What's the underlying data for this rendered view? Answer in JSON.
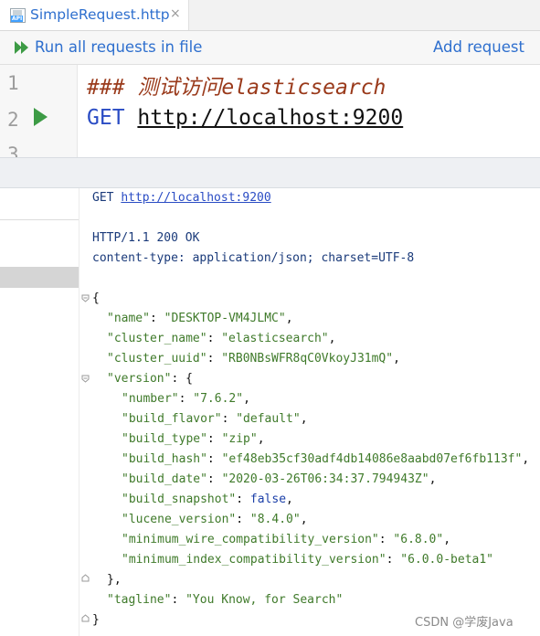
{
  "tab": {
    "title": "SimpleRequest.http",
    "icon_label": "API",
    "close": "×"
  },
  "toolbar": {
    "run_all": "Run all requests in file",
    "add_request": "Add request"
  },
  "editor": {
    "line_numbers": [
      "1",
      "2",
      "3"
    ],
    "line1": "### 测试访问elasticsearch",
    "line2_method": "GET",
    "line2_url": "http://localhost:9200"
  },
  "response": {
    "request_method": "GET",
    "request_url": "http://localhost:9200",
    "status": "HTTP/1.1 200 OK",
    "content_type": "content-type: application/json; charset=UTF-8",
    "body": [
      {
        "k": null,
        "text": "{"
      },
      {
        "k": "\"name\"",
        "v": "\"DESKTOP-VM4JLMC\"",
        "end": ","
      },
      {
        "k": "\"cluster_name\"",
        "v": "\"elasticsearch\"",
        "end": ","
      },
      {
        "k": "\"cluster_uuid\"",
        "v": "\"RB0NBsWFR8qC0VkoyJ31mQ\"",
        "end": ","
      },
      {
        "k": "\"version\"",
        "v": "{",
        "end": ""
      },
      {
        "k": "\"number\"",
        "v": "\"7.6.2\"",
        "end": ","
      },
      {
        "k": "\"build_flavor\"",
        "v": "\"default\"",
        "end": ","
      },
      {
        "k": "\"build_type\"",
        "v": "\"zip\"",
        "end": ","
      },
      {
        "k": "\"build_hash\"",
        "v": "\"ef48eb35cf30adf4db14086e8aabd07ef6fb113f\"",
        "end": ","
      },
      {
        "k": "\"build_date\"",
        "v": "\"2020-03-26T06:34:37.794943Z\"",
        "end": ","
      },
      {
        "k": "\"build_snapshot\"",
        "v": "false",
        "end": ","
      },
      {
        "k": "\"lucene_version\"",
        "v": "\"8.4.0\"",
        "end": ","
      },
      {
        "k": "\"minimum_wire_compatibility_version\"",
        "v": "\"6.8.0\"",
        "end": ","
      },
      {
        "k": "\"minimum_index_compatibility_version\"",
        "v": "\"6.0.0-beta1\"",
        "end": ""
      },
      {
        "k": null,
        "text": "},"
      },
      {
        "k": "\"tagline\"",
        "v": "\"You Know, for Search\"",
        "end": ""
      },
      {
        "k": null,
        "text": "}"
      }
    ]
  },
  "watermark": "CSDN @学废Java",
  "colors": {
    "accent": "#2e6fce",
    "run_green": "#3d9b45",
    "comment": "#9a3a1b"
  }
}
